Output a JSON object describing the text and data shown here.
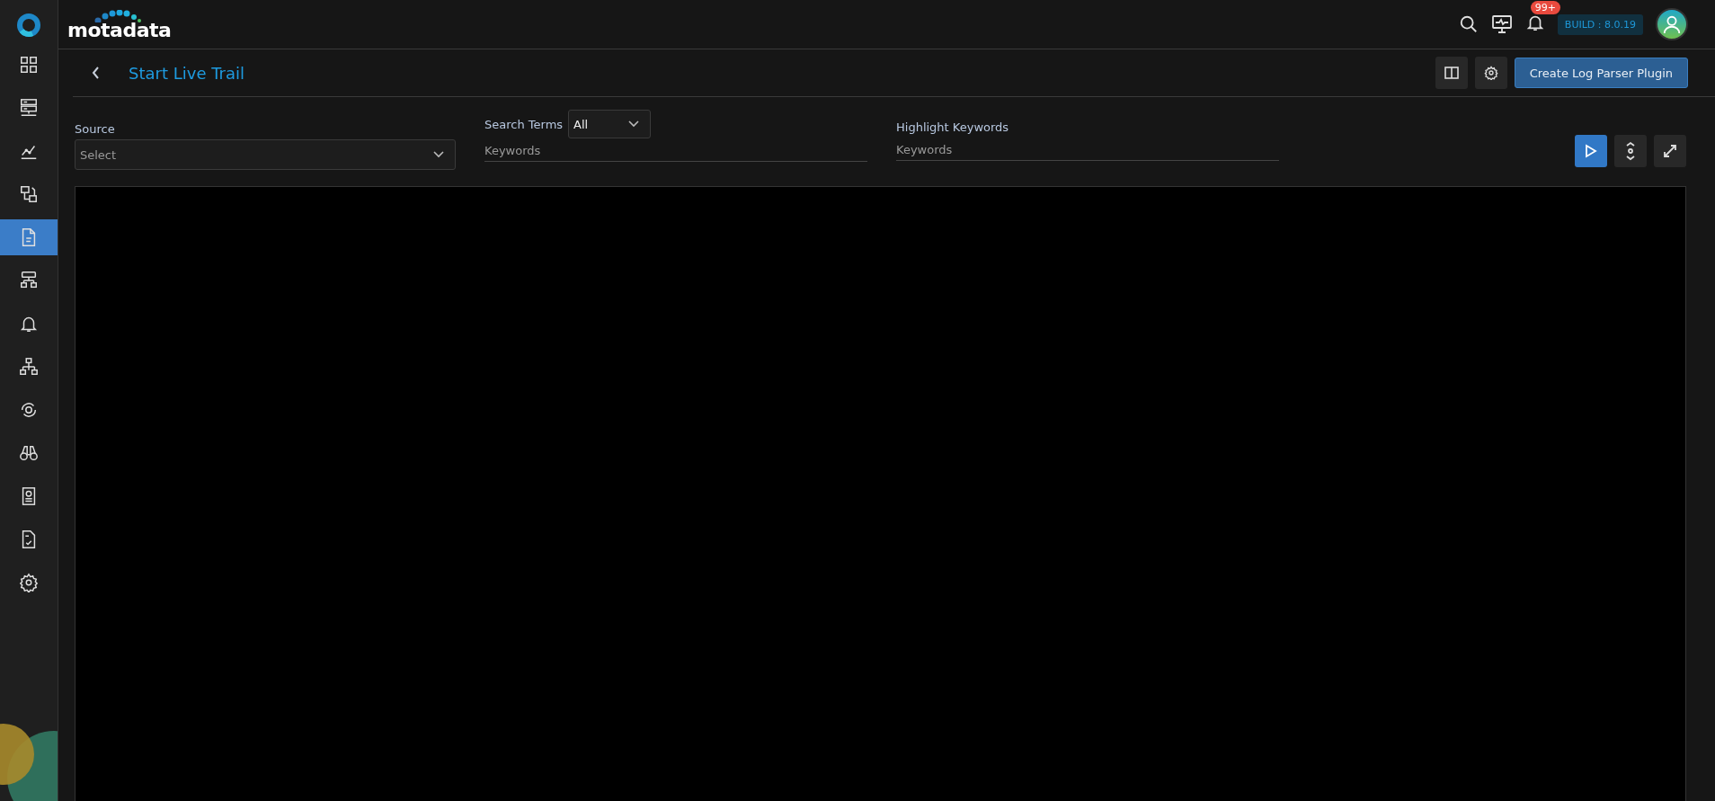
{
  "sidebar": {
    "items": [
      {
        "kind": "grid",
        "selected": false
      },
      {
        "kind": "servers",
        "selected": false
      },
      {
        "kind": "chart",
        "selected": false
      },
      {
        "kind": "flow",
        "selected": false
      },
      {
        "kind": "document",
        "selected": true
      },
      {
        "kind": "hierarchy",
        "selected": false
      },
      {
        "kind": "bell",
        "selected": false
      },
      {
        "kind": "network",
        "selected": false
      },
      {
        "kind": "sync",
        "selected": false
      },
      {
        "kind": "binoculars",
        "selected": false
      },
      {
        "kind": "report",
        "selected": false
      },
      {
        "kind": "checklist",
        "selected": false
      },
      {
        "kind": "settings",
        "selected": false
      }
    ]
  },
  "header": {
    "logo": "motadata",
    "notification_count": "99+",
    "build": "BUILD : 8.0.19"
  },
  "page": {
    "title": "Start Live Trail",
    "action_button": "Create Log Parser Plugin"
  },
  "filters": {
    "source": {
      "label": "Source",
      "placeholder": "Select"
    },
    "search_terms": {
      "label": "Search Terms",
      "value": "All",
      "placeholder": "Keywords"
    },
    "highlight": {
      "label": "Highlight Keywords",
      "placeholder": "Keywords"
    }
  }
}
